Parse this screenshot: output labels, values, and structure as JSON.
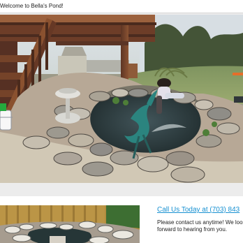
{
  "window": {
    "title": "Welcome to Bella's Pond!"
  },
  "contact": {
    "heading": "Call Us Today at (703) 843",
    "message": "Please contact us anytime! We look forward to hearing from you."
  }
}
